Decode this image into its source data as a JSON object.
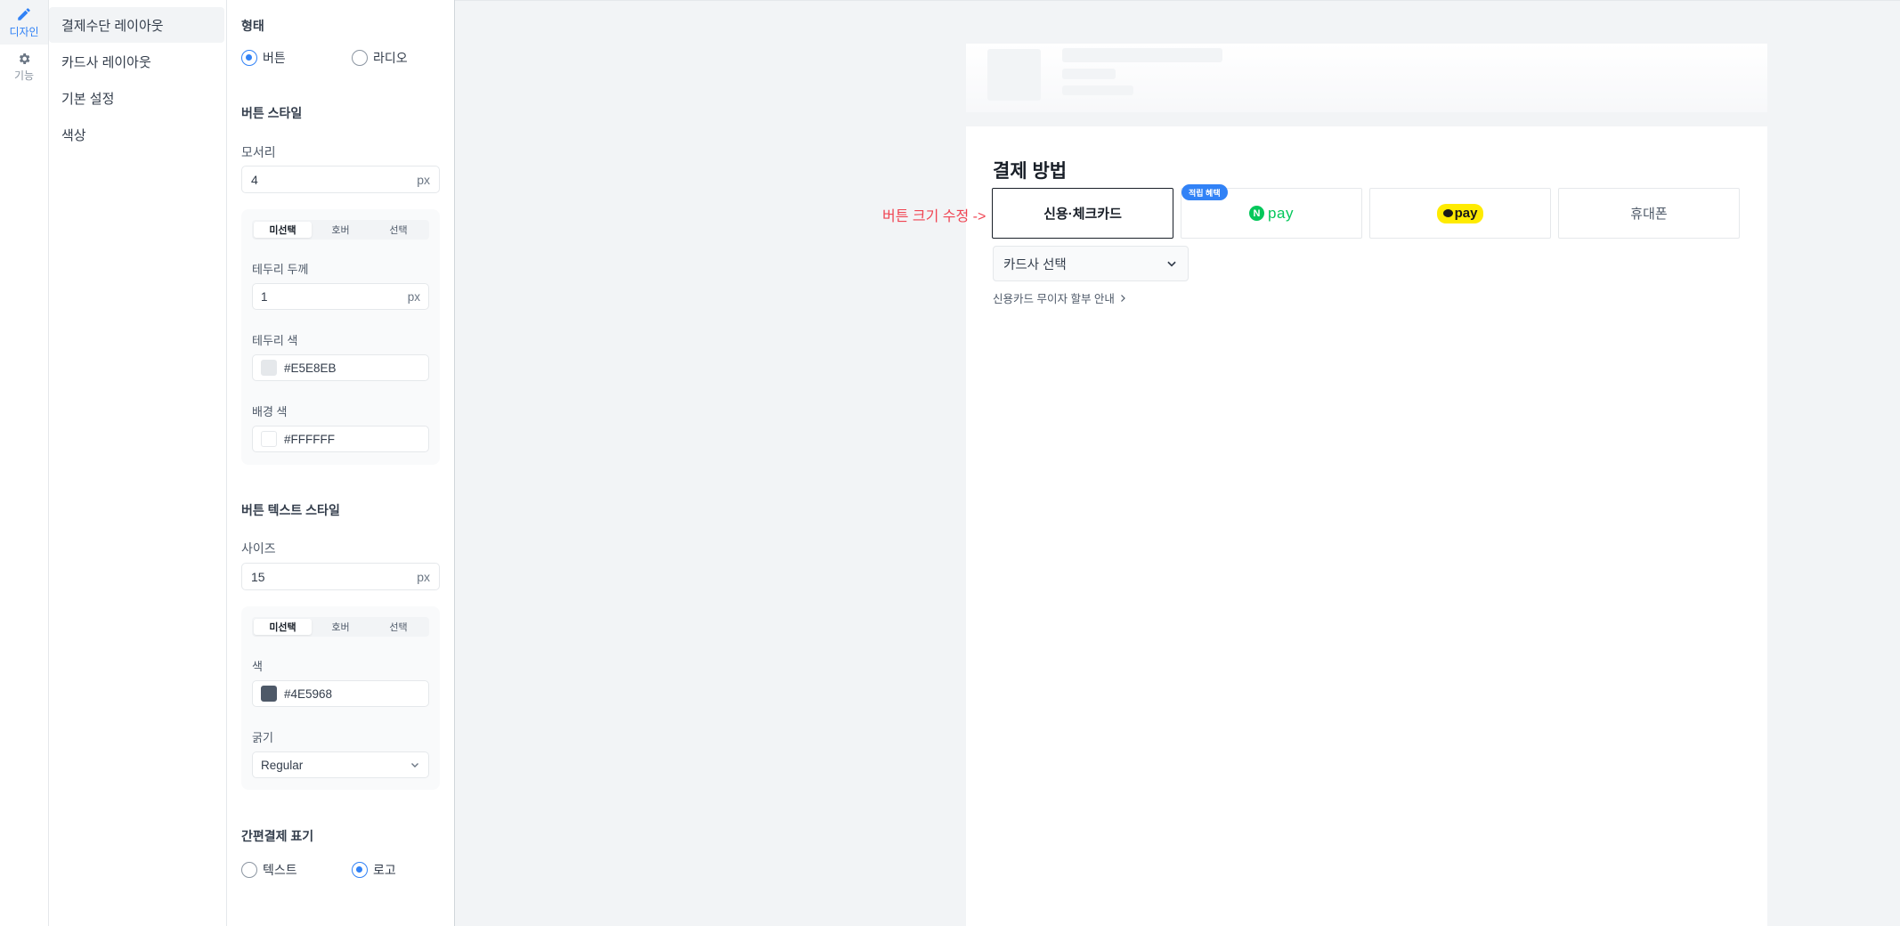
{
  "rail": {
    "design": {
      "label": "디자인",
      "icon": "pencil-icon"
    },
    "features": {
      "label": "기능",
      "icon": "gear-icon"
    }
  },
  "menu": {
    "items": [
      {
        "label": "결제수단 레이아웃"
      },
      {
        "label": "카드사 레이아웃"
      },
      {
        "label": "기본 설정"
      },
      {
        "label": "색상"
      }
    ]
  },
  "settings": {
    "form": {
      "title": "형태",
      "options": [
        "버튼",
        "라디오"
      ],
      "selected": "버튼"
    },
    "button_style": {
      "title": "버튼 스타일",
      "radius_label": "모서리",
      "radius_value": "4",
      "unit": "px",
      "tabs": [
        "미선택",
        "호버",
        "선택"
      ],
      "active_tab": "미선택",
      "border_width_label": "테두리 두께",
      "border_width_value": "1",
      "border_color_label": "테두리 색",
      "border_color_value": "#E5E8EB",
      "bg_color_label": "배경 색",
      "bg_color_value": "#FFFFFF"
    },
    "text_style": {
      "title": "버튼 텍스트 스타일",
      "size_label": "사이즈",
      "size_value": "15",
      "unit": "px",
      "tabs": [
        "미선택",
        "호버",
        "선택"
      ],
      "active_tab": "미선택",
      "color_label": "색",
      "color_value": "#4E5968",
      "weight_label": "굵기",
      "weight_value": "Regular"
    },
    "easy_pay": {
      "title": "간편결제 표기",
      "options": [
        "텍스트",
        "로고"
      ],
      "selected": "로고"
    }
  },
  "preview": {
    "title": "결제 방법",
    "methods": [
      {
        "label": "신용·체크카드",
        "selected": true
      },
      {
        "label": "pay",
        "logo": "naver-pay",
        "badge": "적립 혜택"
      },
      {
        "label": "pay",
        "logo": "kakao-pay"
      },
      {
        "label": "휴대폰"
      }
    ],
    "card_select_placeholder": "카드사 선택",
    "installment_link": "신용카드 무이자 할부 안내",
    "annotation": "버튼 크기 수정 ->"
  },
  "colors": {
    "accent": "#3182f6",
    "naver": "#03c75a",
    "kakao": "#ffeb00",
    "annotation": "#f04452"
  }
}
